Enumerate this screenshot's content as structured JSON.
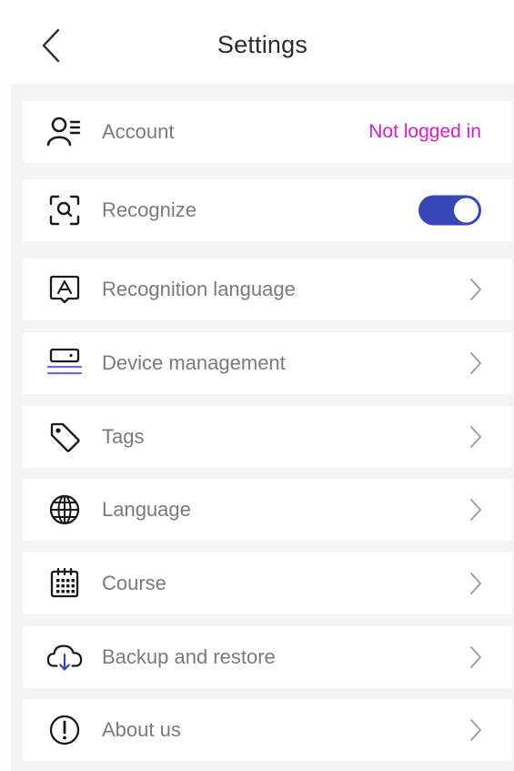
{
  "header": {
    "title": "Settings"
  },
  "account": {
    "label": "Account",
    "status": "Not logged in",
    "status_color": "#d81ec8"
  },
  "recognize": {
    "label": "Recognize",
    "enabled": true,
    "toggle_color": "#3747b8"
  },
  "menu": [
    {
      "label": "Recognition language",
      "icon": "recognition-language-icon"
    },
    {
      "label": "Device management",
      "icon": "device-management-icon"
    },
    {
      "label": "Tags",
      "icon": "tag-icon"
    },
    {
      "label": "Language",
      "icon": "globe-icon"
    },
    {
      "label": "Course",
      "icon": "calendar-icon"
    },
    {
      "label": "Backup and restore",
      "icon": "cloud-download-icon"
    },
    {
      "label": "About us",
      "icon": "info-icon"
    }
  ],
  "colors": {
    "accent": "#3747b8",
    "device_accent": "#6a6ad4"
  }
}
